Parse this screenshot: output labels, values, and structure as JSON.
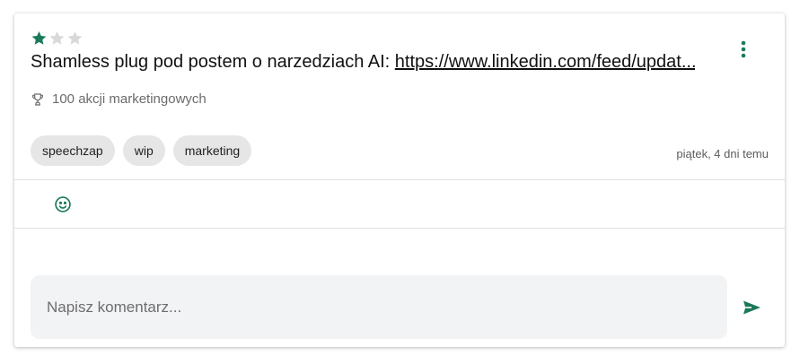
{
  "post": {
    "rating": {
      "value": 1,
      "max": 3
    },
    "title_text": "Shamless plug pod postem o narzedziach AI: ",
    "title_link": "https://www.linkedin.com/feed/updat...",
    "goal_label": "100 akcji marketingowych",
    "tags": [
      "speechzap",
      "wip",
      "marketing"
    ],
    "date": "piątek, 4 dni temu"
  },
  "comment": {
    "placeholder": "Napisz komentarz..."
  },
  "colors": {
    "accent": "#1a7a5a",
    "star_inactive": "#d9d9d9"
  },
  "icons": {
    "rating": "star-icon",
    "menu": "more-vertical-icon",
    "goal": "trophy-icon",
    "reaction": "smiley-icon",
    "send": "send-icon"
  }
}
